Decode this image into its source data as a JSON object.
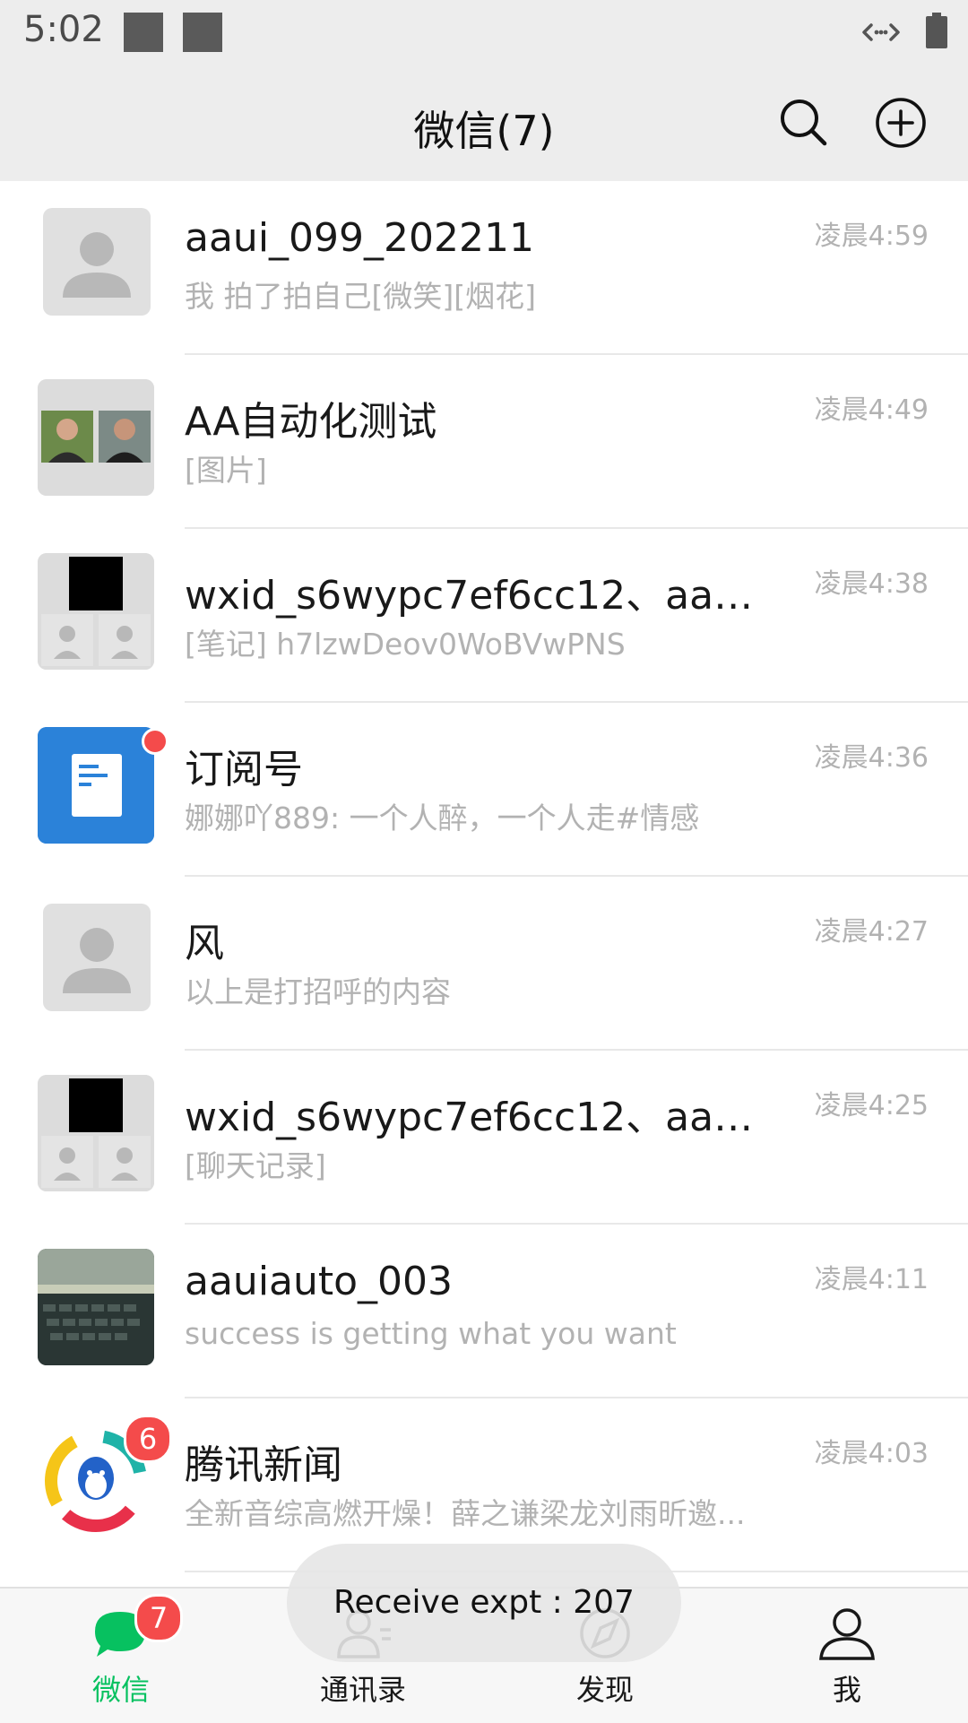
{
  "status_bar": {
    "time": "5:02"
  },
  "header": {
    "title": "微信(7)"
  },
  "chats": [
    {
      "name": "aaui_099_202211",
      "message": "我 拍了拍自己[微笑][烟花]",
      "time": "凌晨4:59"
    },
    {
      "name": "AA自动化测试",
      "message": "[图片]",
      "time": "凌晨4:49"
    },
    {
      "name": "wxid_s6wypc7ef6cc12、aaui_...",
      "message": "[笔记] h7lzwDeov0WoBVwPNS",
      "time": "凌晨4:38"
    },
    {
      "name": "订阅号",
      "message": "娜娜吖889: 一个人醉，一个人走#情感",
      "time": "凌晨4:36"
    },
    {
      "name": "风",
      "message": "以上是打招呼的内容",
      "time": "凌晨4:27"
    },
    {
      "name": "wxid_s6wypc7ef6cc12、aaui_...",
      "message": "[聊天记录]",
      "time": "凌晨4:25"
    },
    {
      "name": "aauiauto_003",
      "message": "success is getting what you want",
      "time": "凌晨4:11"
    },
    {
      "name": "腾讯新闻",
      "message": "全新音综高燃开燥！薛之谦梁龙刘雨昕邀...",
      "time": "凌晨4:03",
      "badge": "6"
    }
  ],
  "tabs": [
    {
      "label": "微信",
      "badge": "7"
    },
    {
      "label": "通讯录"
    },
    {
      "label": "发现"
    },
    {
      "label": "我"
    }
  ],
  "toast": {
    "text": "Receive expt : 207"
  },
  "colors": {
    "accent": "#07c160",
    "badge": "#f44b4b",
    "header_bg": "#ededed"
  }
}
